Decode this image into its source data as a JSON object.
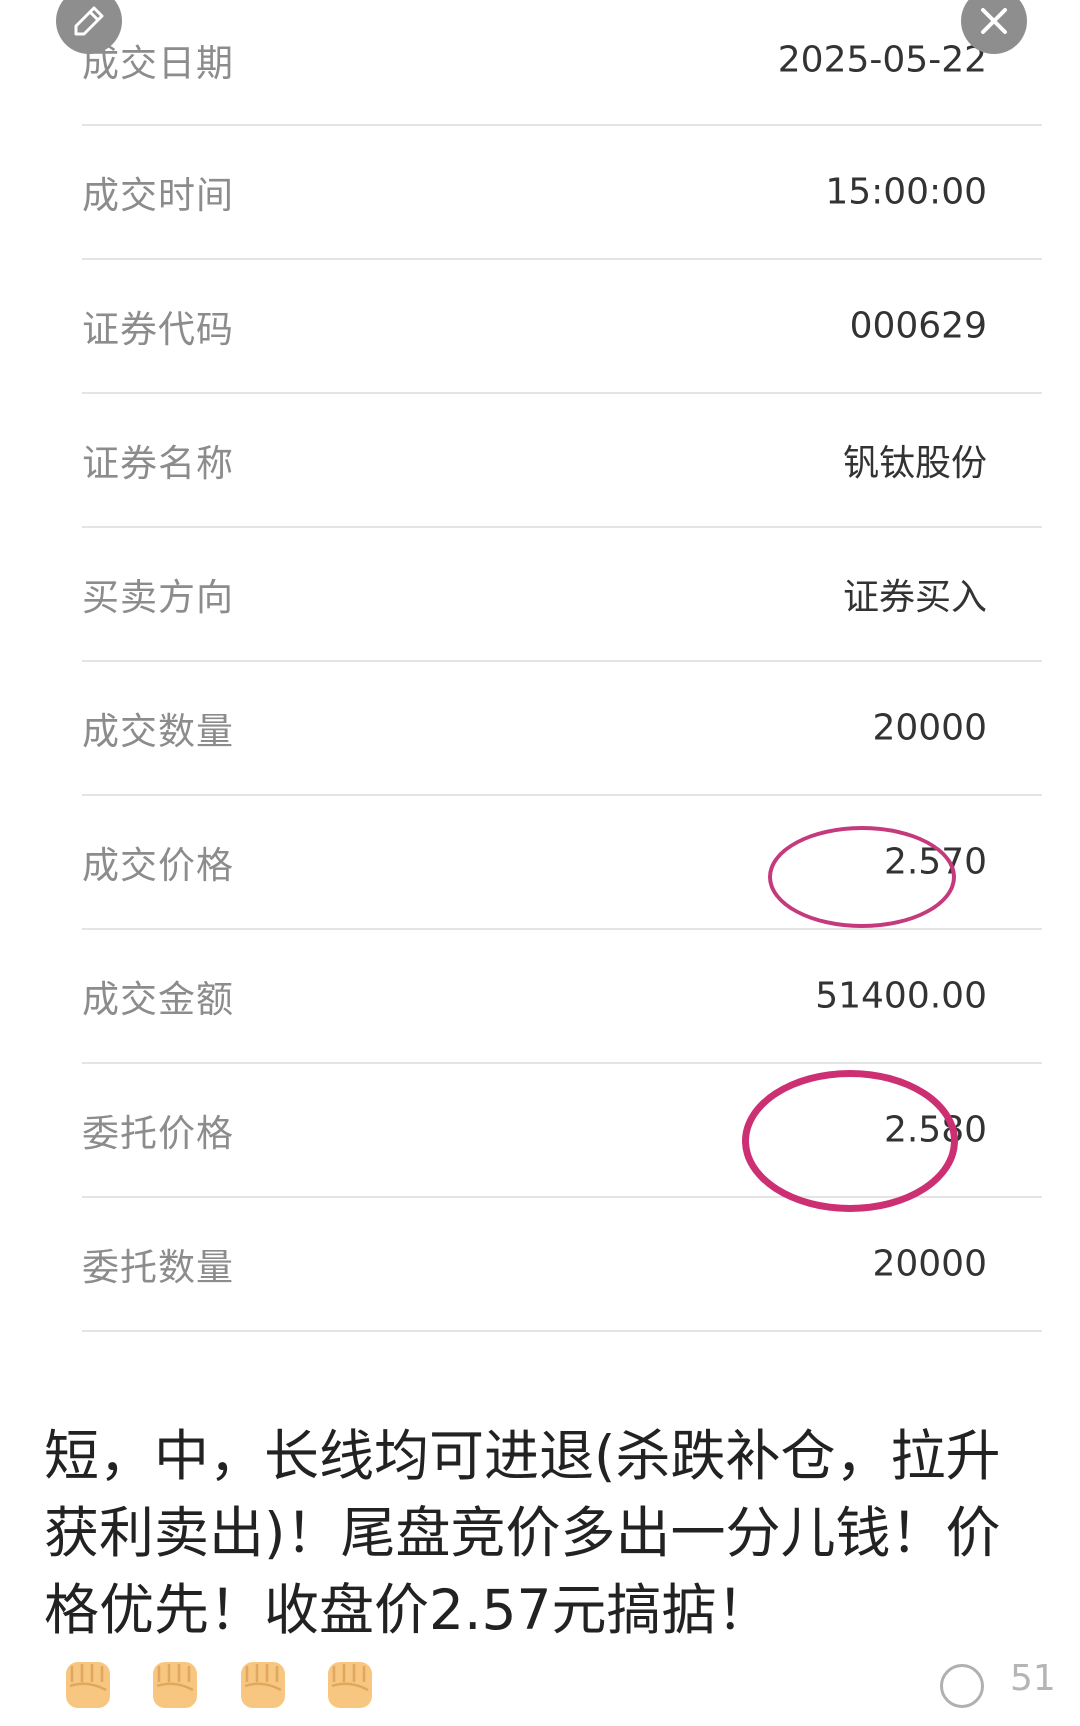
{
  "trade_details": [
    {
      "label": "成交日期",
      "value": "2025-05-22"
    },
    {
      "label": "成交时间",
      "value": "15:00:00"
    },
    {
      "label": "证券代码",
      "value": "000629"
    },
    {
      "label": "证券名称",
      "value": "钒钛股份"
    },
    {
      "label": "买卖方向",
      "value": "证券买入"
    },
    {
      "label": "成交数量",
      "value": "20000"
    },
    {
      "label": "成交价格",
      "value": "2.570"
    },
    {
      "label": "成交金额",
      "value": "51400.00"
    },
    {
      "label": "委托价格",
      "value": "2.580"
    },
    {
      "label": "委托数量",
      "value": "20000"
    }
  ],
  "caption": {
    "text": "短，中，长线均可进退(杀跌补仓，拉升获利卖出)！尾盘竞价多出一分儿钱！价格优先！收盘价2.57元搞掂！",
    "emoji_icons": [
      "raised-fist-icon",
      "raised-fist-icon",
      "raised-fist-icon",
      "raised-fist-icon"
    ]
  },
  "footer": {
    "count": "51"
  },
  "colors": {
    "highlight_circle": "#c43a7c",
    "emoji_skin": "#f7c680"
  }
}
